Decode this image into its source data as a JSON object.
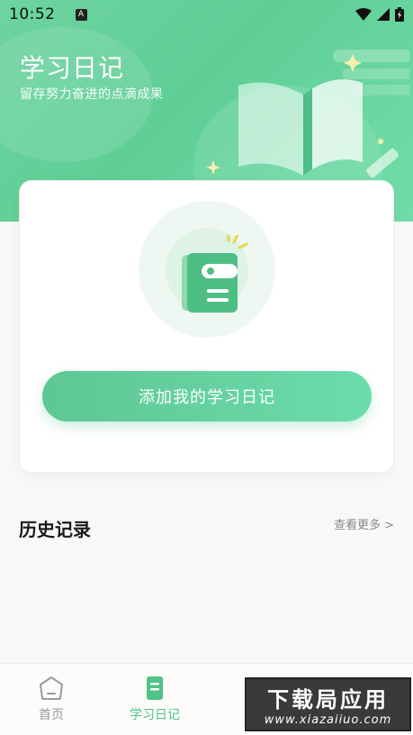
{
  "status_bar": {
    "time": "10:52",
    "notification_letter": "A"
  },
  "header": {
    "title": "学习日记",
    "subtitle": "留存努力奋进的点滴成果"
  },
  "card": {
    "add_button_label": "添加我的学习日记"
  },
  "history": {
    "title": "历史记录",
    "more_label": "查看更多 >"
  },
  "bottom_nav": {
    "items": [
      {
        "label": "首页",
        "icon": "home-icon",
        "active": false
      },
      {
        "label": "学习日记",
        "icon": "diary-icon",
        "active": true
      },
      {
        "label": "",
        "icon": "profile-icon",
        "active": false
      }
    ]
  },
  "watermark": {
    "big": "下载局应用",
    "small": "www.xiazaiiuo.com"
  },
  "colors": {
    "accent": "#5ec794",
    "header_bg": "#6ed3a0",
    "page_bg": "#faf8f6"
  }
}
